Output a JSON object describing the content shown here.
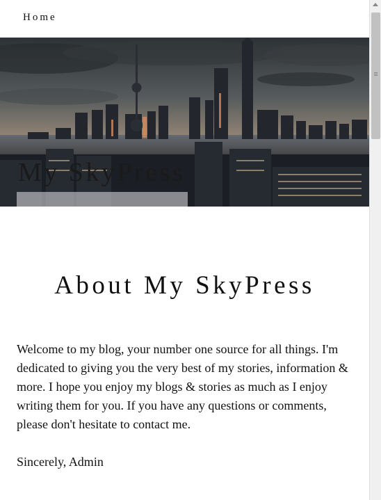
{
  "nav": {
    "home_label": "Home"
  },
  "hero": {
    "site_title": "My SkyPress"
  },
  "main": {
    "heading": "About My SkyPress",
    "body": "Welcome to my blog, your number one source for all things. I'm dedicated to giving you the very best of my stories, information & more. I hope you enjoy my blogs & stories as much as I enjoy writing them for you. If you have any questions or comments, please don't hesitate to contact me.",
    "signoff": "Sincerely, Admin"
  },
  "colors": {
    "sky_top": "#2f3438",
    "sky_mid": "#6b6863",
    "horizon_glow": "#c9a27a",
    "city_dark": "#1c2026",
    "title_box": "#cdcdd2"
  },
  "icons": {
    "scroll_up": "triangle-up-icon",
    "thumb_grip": "grip-lines-icon"
  }
}
